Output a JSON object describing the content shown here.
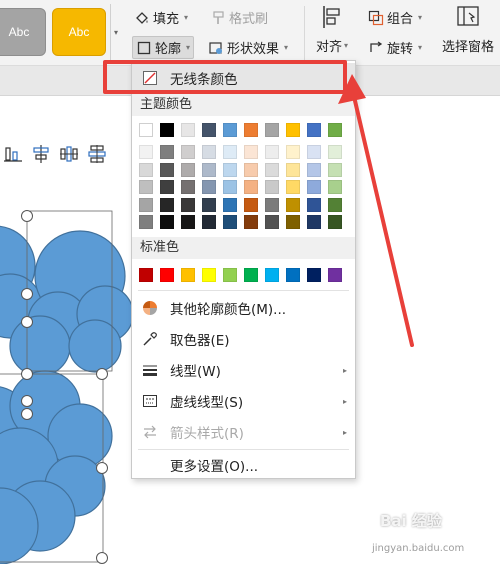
{
  "ribbon": {
    "style_swatches": [
      {
        "label": "Abc",
        "color": "#a4a4a4"
      },
      {
        "label": "Abc",
        "color": "#f6b800"
      }
    ],
    "fill_label": "填充",
    "format_painter_label": "格式刷",
    "outline_label": "轮廓",
    "shape_effect_label": "形状效果",
    "align_label": "对齐",
    "group_label": "组合",
    "rotate_label": "旋转",
    "selection_pane_label": "选择窗格"
  },
  "menu": {
    "no_line_label": "无线条颜色",
    "theme_colors_heading": "主题颜色",
    "theme_colors": [
      [
        "#ffffff",
        "#000000",
        "#e7e6e6",
        "#44546a",
        "#5b9bd5",
        "#ed7d31",
        "#a5a5a5",
        "#ffc000",
        "#4472c4",
        "#70ad47"
      ],
      [
        "#f2f2f2",
        "#7f7f7f",
        "#d0cece",
        "#d6dce4",
        "#deebf6",
        "#fbe5d5",
        "#ededed",
        "#fff2cc",
        "#d9e2f3",
        "#e2efd9"
      ],
      [
        "#d8d8d8",
        "#595959",
        "#aeabab",
        "#adb9ca",
        "#bdd7ee",
        "#f7cbac",
        "#dbdbdb",
        "#fee599",
        "#b4c6e7",
        "#c5e0b3"
      ],
      [
        "#bfbfbf",
        "#3f3f3f",
        "#757070",
        "#8496b0",
        "#9cc3e5",
        "#f4b183",
        "#c9c9c9",
        "#ffd965",
        "#8eaadb",
        "#a8d08d"
      ],
      [
        "#a5a5a5",
        "#262626",
        "#3a3838",
        "#323f4f",
        "#2e75b5",
        "#c55a11",
        "#7b7b7b",
        "#bf9000",
        "#2f5496",
        "#538135"
      ],
      [
        "#7f7f7f",
        "#0d0d0d",
        "#171616",
        "#222a35",
        "#1e4e79",
        "#843c0c",
        "#525252",
        "#7f6000",
        "#1f3864",
        "#375623"
      ]
    ],
    "standard_colors_heading": "标准色",
    "standard_colors": [
      "#c00000",
      "#ff0000",
      "#ffc000",
      "#ffff00",
      "#92d050",
      "#00b050",
      "#00b0f0",
      "#0070c0",
      "#002060",
      "#7030a0"
    ],
    "more_outline_colors_label": "其他轮廓颜色(M)...",
    "eyedropper_label": "取色器(E)",
    "line_type_label": "线型(W)",
    "dash_type_label": "虚线线型(S)",
    "arrow_style_label": "箭头样式(R)",
    "more_settings_label": "更多设置(O)..."
  },
  "watermark": {
    "text": "Bai 经验",
    "sub": "jingyan.baidu.com"
  },
  "colors": {
    "annotation_red": "#e8403a",
    "shape_fill": "#5b9bd5"
  }
}
